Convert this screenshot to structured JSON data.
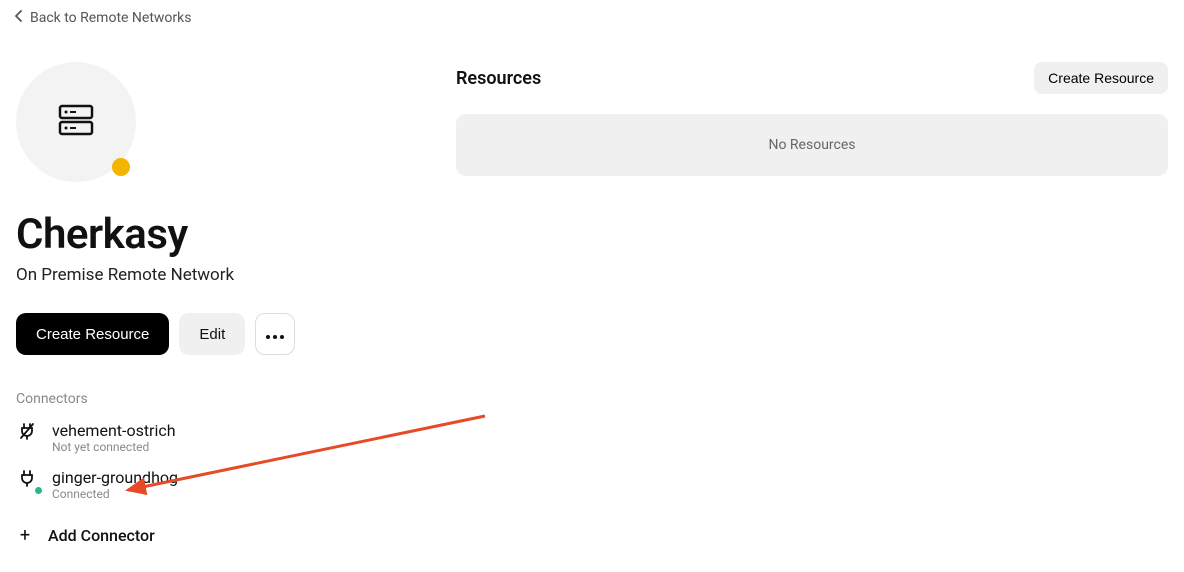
{
  "back_link": "Back to Remote Networks",
  "network": {
    "name": "Cherkasy",
    "subtitle": "On Premise Remote Network"
  },
  "actions": {
    "create_resource": "Create Resource",
    "edit": "Edit"
  },
  "connectors": {
    "heading": "Connectors",
    "items": [
      {
        "name": "vehement-ostrich",
        "status": "Not yet connected"
      },
      {
        "name": "ginger-groundhog",
        "status": "Connected"
      }
    ],
    "add_label": "Add Connector"
  },
  "resources": {
    "heading": "Resources",
    "create_label": "Create Resource",
    "empty_text": "No Resources"
  }
}
